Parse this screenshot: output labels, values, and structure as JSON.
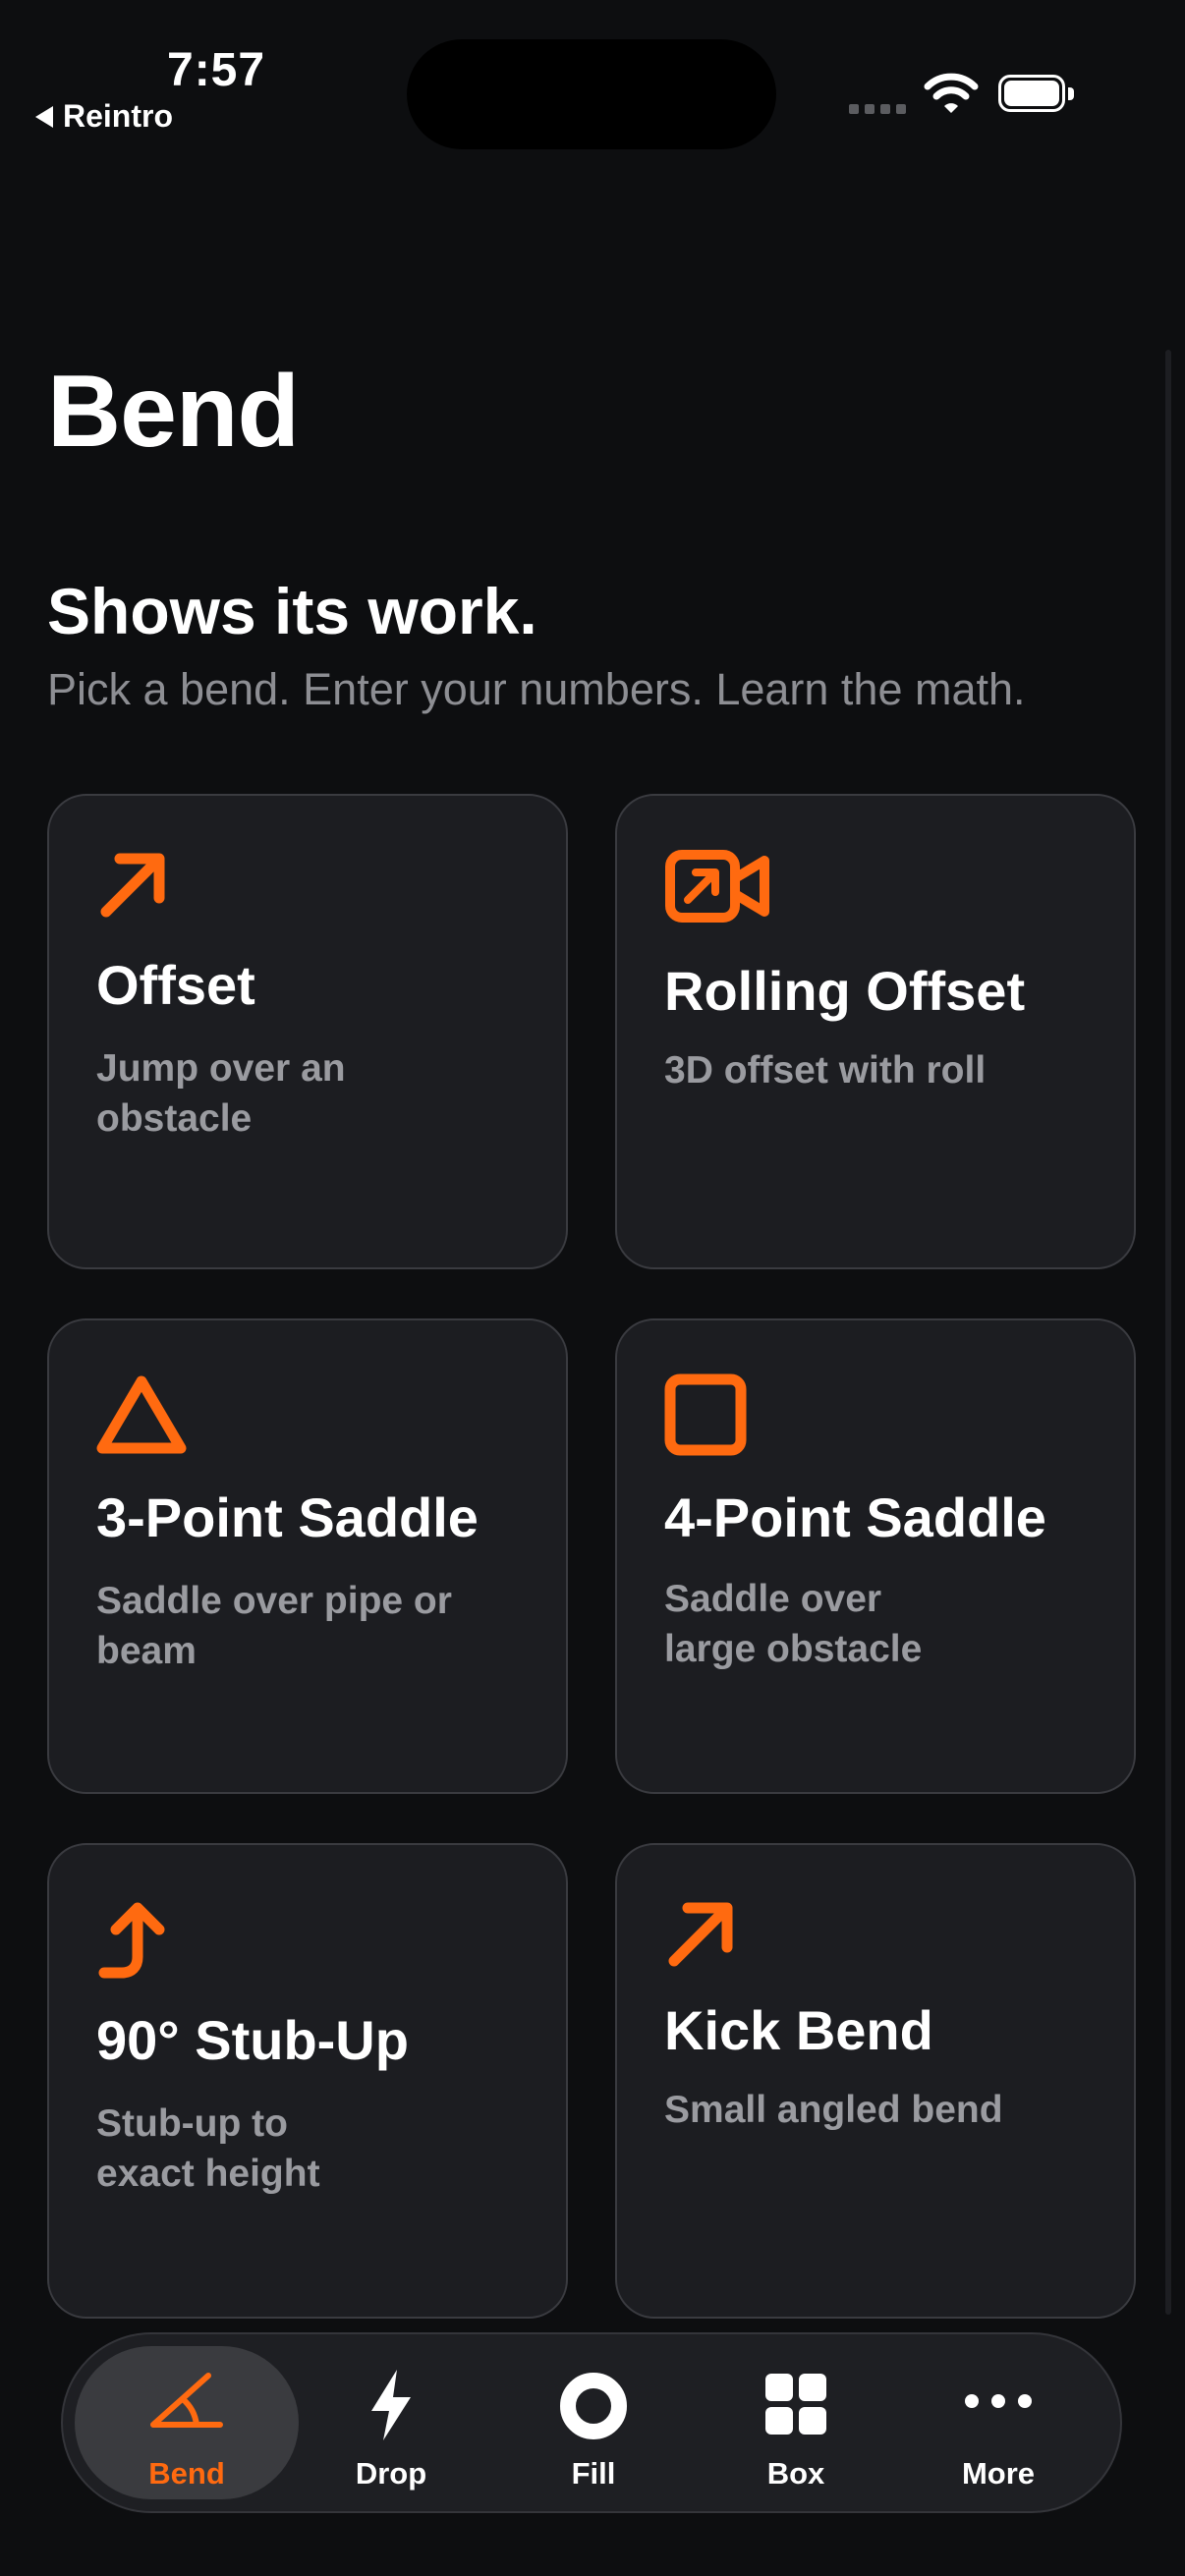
{
  "status": {
    "time": "7:57",
    "back_label": "Reintro"
  },
  "page": {
    "title": "Bend",
    "headline": "Shows its work.",
    "subhead": "Pick a bend. Enter your numbers. Learn the math."
  },
  "accent_color": "#ff6a10",
  "cards": [
    {
      "title": "Offset",
      "desc": "Jump over an obstacle",
      "icon": "arrow-up-right-icon"
    },
    {
      "title": "Rolling Offset",
      "desc": "3D offset with roll",
      "icon": "video-arrow-icon"
    },
    {
      "title": "3-Point Saddle",
      "desc": "Saddle over pipe or beam",
      "icon": "triangle-icon"
    },
    {
      "title": "4-Point Saddle",
      "desc": "Saddle over large obstacle",
      "icon": "square-icon"
    },
    {
      "title": "90° Stub-Up",
      "desc": "Stub-up to exact height",
      "icon": "bent-arrow-up-icon"
    },
    {
      "title": "Kick Bend",
      "desc": "Small angled bend",
      "icon": "arrow-up-right-icon"
    }
  ],
  "tabs": [
    {
      "label": "Bend",
      "icon": "angle-icon",
      "active": true
    },
    {
      "label": "Drop",
      "icon": "bolt-icon"
    },
    {
      "label": "Fill",
      "icon": "ring-icon"
    },
    {
      "label": "Box",
      "icon": "grid-icon"
    },
    {
      "label": "More",
      "icon": "ellipsis-icon"
    }
  ]
}
